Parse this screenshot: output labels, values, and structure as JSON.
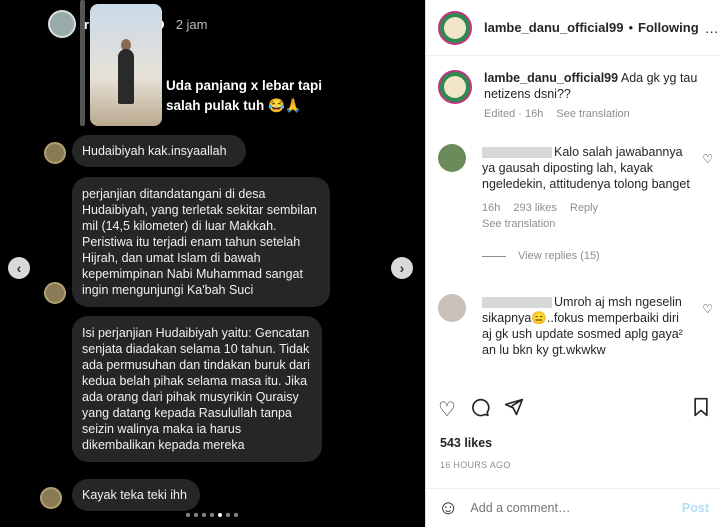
{
  "story": {
    "username": "rizkybillar",
    "time": "2 jam",
    "caption": "Uda panjang x lebar tapi salah pulak tuh 😂🙏"
  },
  "messages": [
    "Hudaibiyah kak.insyaallah",
    "perjanjian ditandatangani di desa Hudaibiyah, yang terletak sekitar sembilan mil (14,5 kilometer) di luar Makkah. Peristiwa itu terjadi enam tahun setelah Hijrah, dan umat Islam di bawah kepemimpinan Nabi Muhammad sangat ingin mengunjungi Ka'bah Suci",
    "Isi perjanjian Hudaibiyah yaitu: Gencatan senjata diadakan selama 10 tahun. Tidak ada permusuhan dan tindakan buruk dari kedua belah pihak selama masa itu. Jika ada orang dari pihak musyrikin Quraisy yang datang kepada Rasulullah tanpa seizin walinya maka ia harus dikembalikan kepada mereka",
    "Kayak teka teki ihh"
  ],
  "nav": {
    "prev": "‹",
    "next": "›"
  },
  "header": {
    "account": "lambe_danu_official99",
    "separator": "•",
    "follow_label": "Following",
    "more": "…"
  },
  "caption_post": {
    "account": "lambe_danu_official99",
    "text": "Ada gk yg tau netizens dsni??",
    "edited": "Edited · 16h",
    "see_translation": "See translation"
  },
  "comments": [
    {
      "text": "Kalo salah jawabannya ya gausah diposting lah, kayak ngeledekin, attitudenya tolong banget",
      "time": "16h",
      "likes": "293 likes",
      "reply": "Reply",
      "see_translation": "See translation",
      "view_replies": "View replies (15)"
    },
    {
      "text": "Umroh aj msh ngeselin sikapnya😑..fokus memperbaiki diri aj gk ush update sosmed aplg gaya² an lu bkn ky gt.wkwkw"
    }
  ],
  "likes": "543 likes",
  "age": "16 HOURS AGO",
  "add_comment": {
    "placeholder": "Add a comment…",
    "post_label": "Post"
  },
  "icons": {
    "heart": "heart-icon",
    "comment": "comment-icon",
    "share": "share-icon",
    "save": "bookmark-icon",
    "emoji": "emoji-icon"
  },
  "colors": {
    "accent_blue": "#0095f6",
    "post_disabled": "#b2dffc",
    "media_bg": "#000000"
  }
}
